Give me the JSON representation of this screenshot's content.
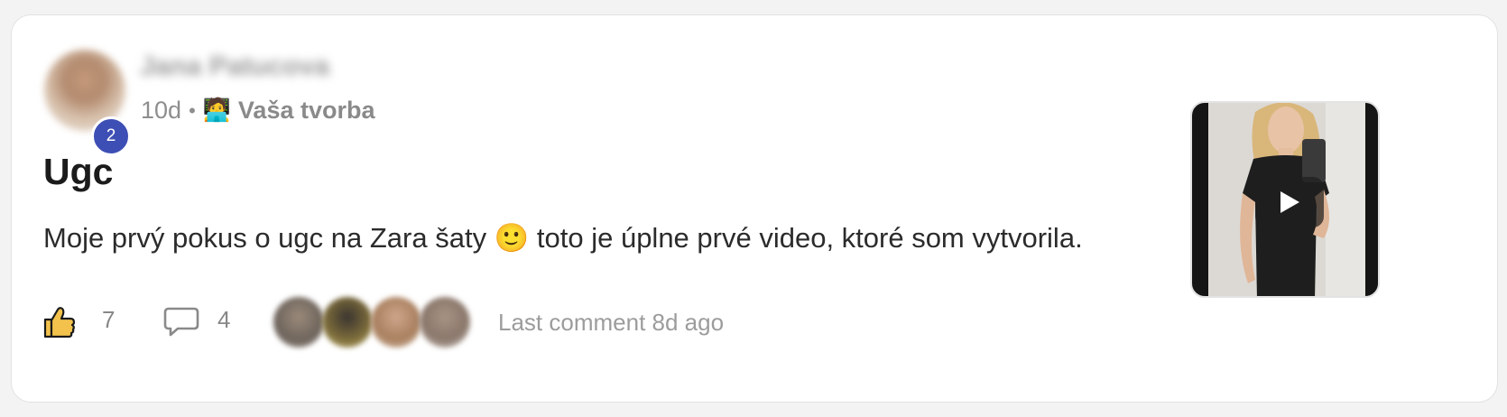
{
  "post": {
    "author_name": "Jana Patucova",
    "author_level": "2",
    "time_ago": "10d",
    "separator": "•",
    "category_icon": "person-laptop-icon",
    "category_emoji": "🧑‍💻",
    "category": "Vaša tvorba",
    "title": "Ugc",
    "body": "Moje prvý pokus o ugc na Zara šaty 🙂 toto je úplne prvé video, ktoré som vytvorila."
  },
  "footer": {
    "like_icon": "thumbs-up-icon",
    "likes": "7",
    "comment_icon": "comment-bubble-icon",
    "comments": "4",
    "last_comment": "Last comment 8d ago"
  },
  "thumbnail": {
    "type": "video",
    "play_icon": "play-icon"
  },
  "colors": {
    "badge": "#3d4fb5",
    "like_fill": "#f2c24c"
  }
}
